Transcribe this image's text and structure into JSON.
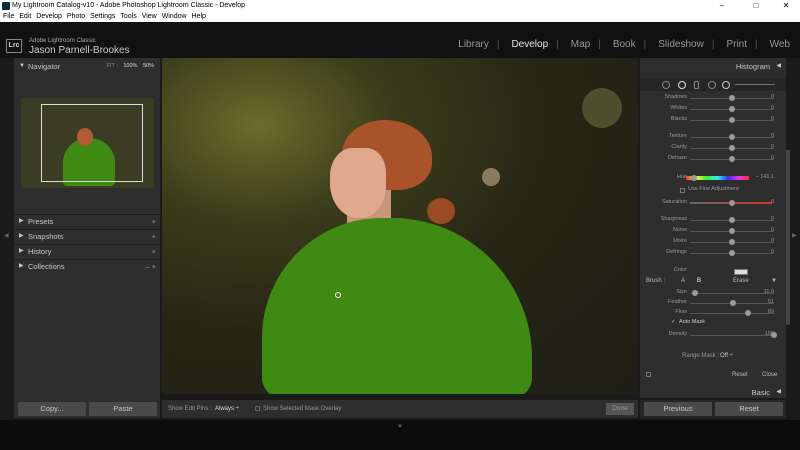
{
  "window": {
    "title": "My Lightroom Catalog-v10 - Adobe Photoshop Lightroom Classic - Develop",
    "minimize": "–",
    "maximize": "□",
    "close": "✕"
  },
  "menubar": [
    "File",
    "Edit",
    "Develop",
    "Photo",
    "Settings",
    "Tools",
    "View",
    "Window",
    "Help"
  ],
  "identity": {
    "logo": "Lrc",
    "product": "Adobe Lightroom Classic",
    "user": "Jason Parnell-Brookes"
  },
  "modules": [
    "Library",
    "Develop",
    "Map",
    "Book",
    "Slideshow",
    "Print",
    "Web"
  ],
  "active_module": "Develop",
  "left_panel": {
    "navigator": {
      "label": "Navigator",
      "zoom_fit": "FIT :",
      "zoom_100": "100%",
      "zoom_50": "50%"
    },
    "presets": {
      "label": "Presets",
      "action": "+"
    },
    "snapshots": {
      "label": "Snapshots",
      "action": "+"
    },
    "history": {
      "label": "History",
      "action": "×"
    },
    "collections": {
      "label": "Collections",
      "action": "– +"
    },
    "copy_button": "Copy...",
    "paste_button": "Paste"
  },
  "toolbar": {
    "edit_pins_label": "Show Edit Pins :",
    "edit_pins_value": "Always ÷",
    "overlay_label": "Show Selected Mask Overlay",
    "done_button": "Done"
  },
  "right_panel": {
    "histogram_label": "Histogram",
    "sliders_top": [
      {
        "label": "Shadows",
        "value": "0",
        "pos": 0.5
      },
      {
        "label": "Whites",
        "value": "0",
        "pos": 0.5
      },
      {
        "label": "Blacks",
        "value": "0",
        "pos": 0.5
      },
      {
        "label": "Texture",
        "value": "0",
        "pos": 0.5
      },
      {
        "label": "Clarity",
        "value": "0",
        "pos": 0.5
      },
      {
        "label": "Dehaze",
        "value": "0",
        "pos": 0.5
      }
    ],
    "hue": {
      "label": "Hue",
      "value": "– 141.1",
      "pos": 0.12
    },
    "fine_adjust": "Use Fine Adjustment",
    "sliders_mid": [
      {
        "label": "Saturation",
        "value": "0",
        "pos": 0.5
      },
      {
        "label": "Sharpness",
        "value": "0",
        "pos": 0.5
      },
      {
        "label": "Noise",
        "value": "0",
        "pos": 0.5
      },
      {
        "label": "Moire",
        "value": "0",
        "pos": 0.5
      },
      {
        "label": "Defringe",
        "value": "0",
        "pos": 0.5
      }
    ],
    "color_label": "Color",
    "brush": {
      "label": "Brush :",
      "a": "A",
      "b": "B",
      "erase": "Erase",
      "size": {
        "label": "Size",
        "value": "11.0",
        "pos": 0.06
      },
      "feather": {
        "label": "Feather",
        "value": "51",
        "pos": 0.51
      },
      "flow": {
        "label": "Flow",
        "value": "69",
        "pos": 0.69
      },
      "auto_mask": "Auto Mask",
      "density": {
        "label": "Density",
        "value": "100",
        "pos": 1.0
      }
    },
    "range_mask_label": "Range Mask :",
    "range_mask_value": "Off ÷",
    "reset": "Reset",
    "close": "Close",
    "basic_label": "Basic",
    "previous_button": "Previous",
    "reset_button": "Reset"
  }
}
